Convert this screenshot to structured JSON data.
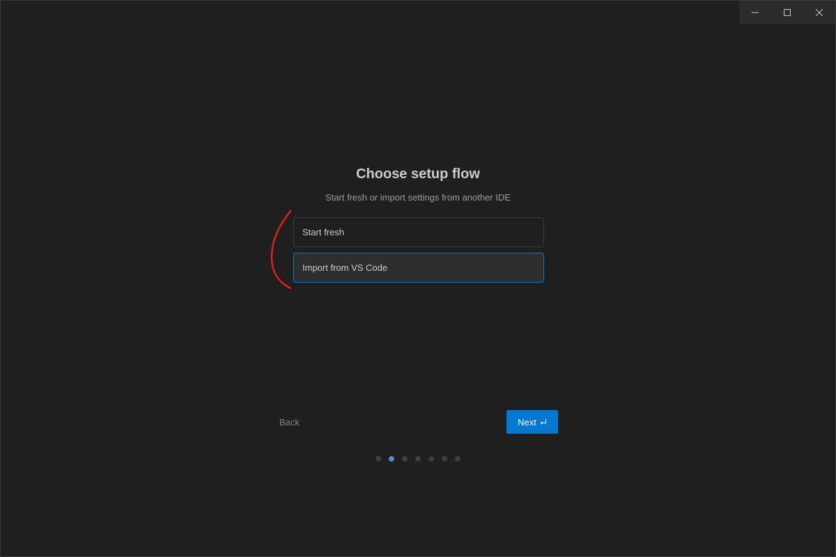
{
  "window": {
    "controls": [
      "minimize-icon",
      "maximize-icon",
      "close-icon"
    ]
  },
  "main": {
    "title": "Choose setup flow",
    "subtitle": "Start fresh or import settings from another IDE",
    "options": [
      {
        "label": "Start fresh",
        "selected": false
      },
      {
        "label": "Import from VS Code",
        "selected": true
      }
    ]
  },
  "footer": {
    "back_label": "Back",
    "next_label": "Next",
    "next_icon": "enter-icon"
  },
  "progress": {
    "total_steps": 7,
    "current_step": 2
  },
  "colors": {
    "accent": "#0078d4",
    "active_dot": "#4e8fd1",
    "annotation": "#e02020"
  }
}
